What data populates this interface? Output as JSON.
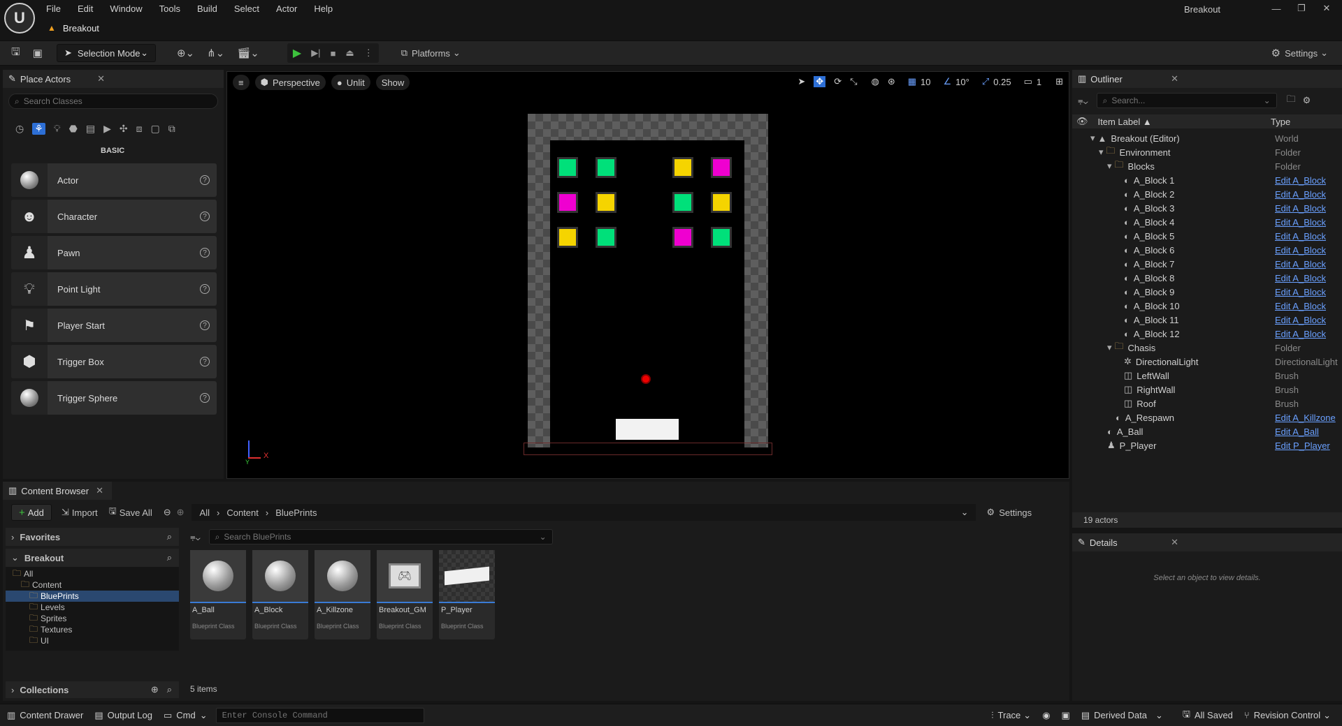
{
  "app": {
    "logo": "unreal-logo",
    "window_title": "Breakout",
    "project_tab": "Breakout"
  },
  "menu": [
    "File",
    "Edit",
    "Window",
    "Tools",
    "Build",
    "Select",
    "Actor",
    "Help"
  ],
  "toolbar": {
    "selection_mode": "Selection Mode",
    "platforms": "Platforms",
    "settings": "Settings"
  },
  "place_actors": {
    "tab": "Place Actors",
    "search_placeholder": "Search Classes",
    "category": "BASIC",
    "items": [
      {
        "label": "Actor"
      },
      {
        "label": "Character"
      },
      {
        "label": "Pawn"
      },
      {
        "label": "Point Light"
      },
      {
        "label": "Player Start"
      },
      {
        "label": "Trigger Box"
      },
      {
        "label": "Trigger Sphere"
      }
    ]
  },
  "viewport": {
    "menu": "≡",
    "perspective": "Perspective",
    "view_mode": "Unlit",
    "show": "Show",
    "grid_snap": "10",
    "rotation_snap": "10°",
    "scale_snap": "0.25",
    "camera_speed": "1",
    "axis_x": "X",
    "axis_y": "Y",
    "colors": {
      "green": "#00e07a",
      "yellow": "#f5d400",
      "magenta": "#ef00d0"
    },
    "blocks": [
      [
        "green",
        "green",
        null,
        "yellow",
        "magenta"
      ],
      [
        "magenta",
        "yellow",
        null,
        "green",
        "yellow"
      ],
      [
        "yellow",
        "green",
        null,
        "magenta",
        "green"
      ]
    ]
  },
  "outliner": {
    "tab": "Outliner",
    "search_placeholder": "Search...",
    "col_label": "Item Label ▲",
    "col_type": "Type",
    "rows": [
      {
        "label": "Breakout (Editor)",
        "type": "World",
        "indent": 1,
        "kind": "world",
        "link": false
      },
      {
        "label": "Environment",
        "type": "Folder",
        "indent": 2,
        "kind": "folder",
        "link": false
      },
      {
        "label": "Blocks",
        "type": "Folder",
        "indent": 3,
        "kind": "folder",
        "link": false
      },
      {
        "label": "A_Block 1",
        "type": "Edit A_Block",
        "indent": 4,
        "kind": "actor",
        "link": true
      },
      {
        "label": "A_Block 2",
        "type": "Edit A_Block",
        "indent": 4,
        "kind": "actor",
        "link": true
      },
      {
        "label": "A_Block 3",
        "type": "Edit A_Block",
        "indent": 4,
        "kind": "actor",
        "link": true
      },
      {
        "label": "A_Block 4",
        "type": "Edit A_Block",
        "indent": 4,
        "kind": "actor",
        "link": true
      },
      {
        "label": "A_Block 5",
        "type": "Edit A_Block",
        "indent": 4,
        "kind": "actor",
        "link": true
      },
      {
        "label": "A_Block 6",
        "type": "Edit A_Block",
        "indent": 4,
        "kind": "actor",
        "link": true
      },
      {
        "label": "A_Block 7",
        "type": "Edit A_Block",
        "indent": 4,
        "kind": "actor",
        "link": true
      },
      {
        "label": "A_Block 8",
        "type": "Edit A_Block",
        "indent": 4,
        "kind": "actor",
        "link": true
      },
      {
        "label": "A_Block 9",
        "type": "Edit A_Block",
        "indent": 4,
        "kind": "actor",
        "link": true
      },
      {
        "label": "A_Block 10",
        "type": "Edit A_Block",
        "indent": 4,
        "kind": "actor",
        "link": true
      },
      {
        "label": "A_Block 11",
        "type": "Edit A_Block",
        "indent": 4,
        "kind": "actor",
        "link": true
      },
      {
        "label": "A_Block 12",
        "type": "Edit A_Block",
        "indent": 4,
        "kind": "actor",
        "link": true
      },
      {
        "label": "Chasis",
        "type": "Folder",
        "indent": 3,
        "kind": "folder",
        "link": false
      },
      {
        "label": "DirectionalLight",
        "type": "DirectionalLight",
        "indent": 4,
        "kind": "light",
        "link": false
      },
      {
        "label": "LeftWall",
        "type": "Brush",
        "indent": 4,
        "kind": "brush",
        "link": false
      },
      {
        "label": "RightWall",
        "type": "Brush",
        "indent": 4,
        "kind": "brush",
        "link": false
      },
      {
        "label": "Roof",
        "type": "Brush",
        "indent": 4,
        "kind": "brush",
        "link": false
      },
      {
        "label": "A_Respawn",
        "type": "Edit A_Killzone",
        "indent": 3,
        "kind": "actor",
        "link": true
      },
      {
        "label": "A_Ball",
        "type": "Edit A_Ball",
        "indent": 2,
        "kind": "actor",
        "link": true
      },
      {
        "label": "P_Player",
        "type": "Edit P_Player",
        "indent": 2,
        "kind": "pawn",
        "link": true
      }
    ],
    "count": "19 actors"
  },
  "details": {
    "tab": "Details",
    "empty": "Select an object to view details."
  },
  "content_browser": {
    "tab": "Content Browser",
    "add": "Add",
    "import": "Import",
    "save_all": "Save All",
    "settings": "Settings",
    "path": [
      "All",
      "Content",
      "BluePrints"
    ],
    "favorites": "Favorites",
    "project": "Breakout",
    "tree": [
      {
        "label": "All",
        "indent": 0
      },
      {
        "label": "Content",
        "indent": 1
      },
      {
        "label": "BluePrints",
        "indent": 2,
        "selected": true
      },
      {
        "label": "Levels",
        "indent": 2
      },
      {
        "label": "Sprites",
        "indent": 2
      },
      {
        "label": "Textures",
        "indent": 2
      },
      {
        "label": "UI",
        "indent": 2
      }
    ],
    "collections": "Collections",
    "search_placeholder": "Search BluePrints",
    "assets": [
      {
        "name": "A_Ball",
        "type": "Blueprint Class"
      },
      {
        "name": "A_Block",
        "type": "Blueprint Class"
      },
      {
        "name": "A_Killzone",
        "type": "Blueprint Class"
      },
      {
        "name": "Breakout_GM",
        "type": "Blueprint Class"
      },
      {
        "name": "P_Player",
        "type": "Blueprint Class"
      }
    ],
    "count": "5 items"
  },
  "statusbar": {
    "content_drawer": "Content Drawer",
    "output_log": "Output Log",
    "cmd": "Cmd",
    "console_placeholder": "Enter Console Command",
    "trace": "Trace",
    "derived_data": "Derived Data",
    "all_saved": "All Saved",
    "revision_control": "Revision Control"
  }
}
